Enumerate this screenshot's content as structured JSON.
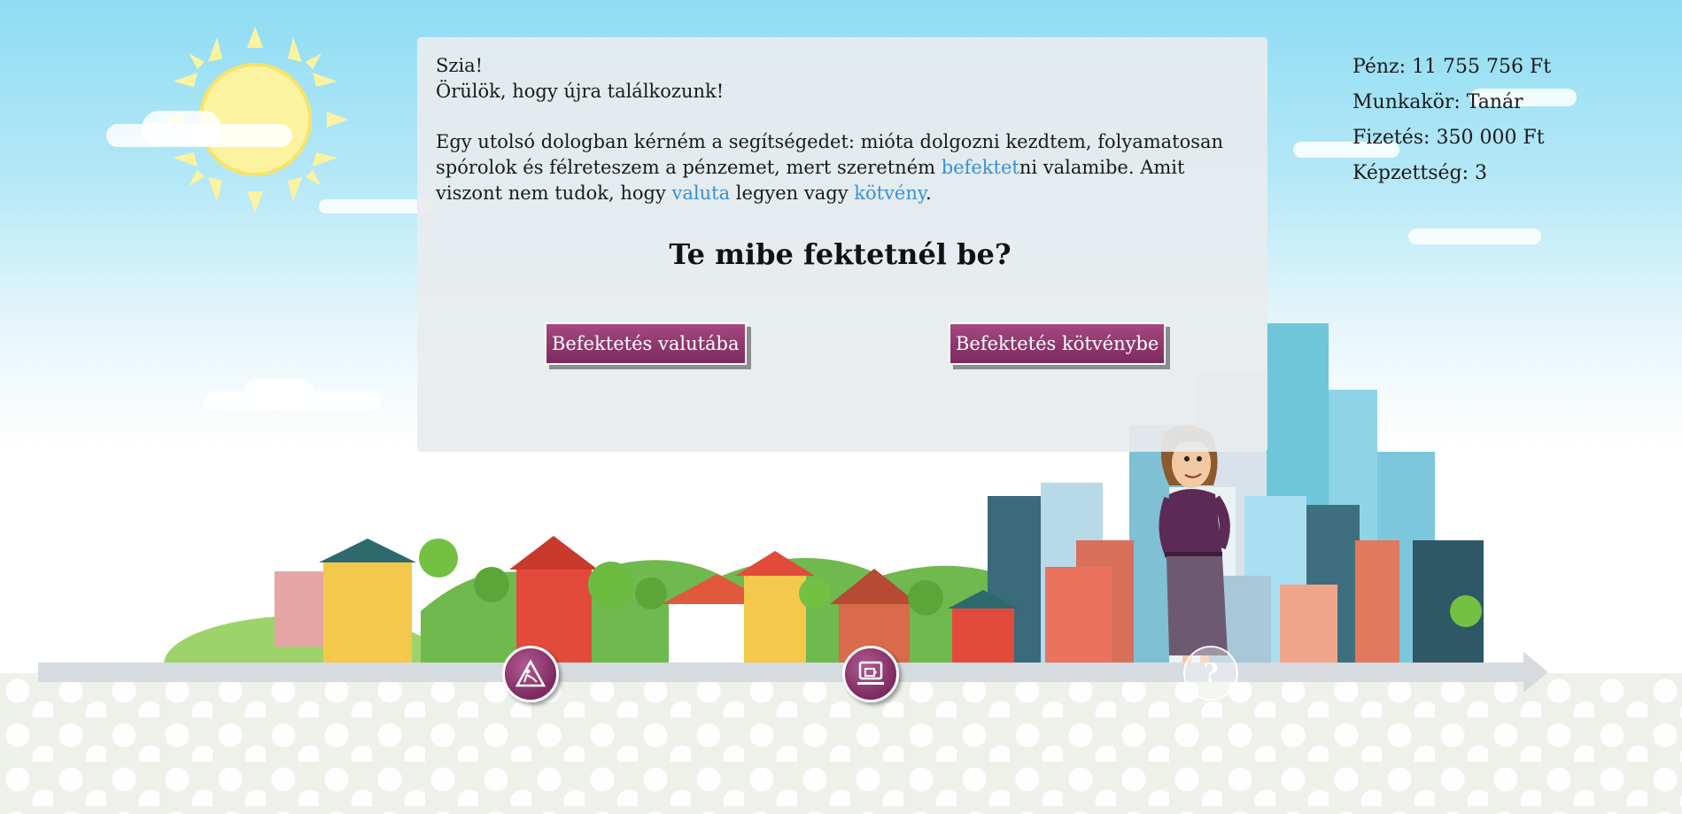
{
  "dialog": {
    "greeting": "Szia!",
    "subgreeting": "Örülök, hogy újra találkozunk!",
    "body_part1": "Egy utolsó dologban kérném a segítségedet: mióta dolgozni kezdtem, folyamatosan spórolok és félreteszem a pénzemet, mert szeretném ",
    "term_invest": "befektet",
    "body_part2": "ni valamibe. Amit viszont nem tudok, hogy ",
    "term_currency": "valuta",
    "body_part3": " legyen vagy ",
    "term_bond": "kötvény",
    "body_part4": ".",
    "question": "Te mibe fektetnél be?",
    "choice_currency": "Befektetés valutába",
    "choice_bond": "Befektetés kötvénybe"
  },
  "stats": {
    "money": "Pénz: 11 755 756 Ft",
    "job": "Munkakör: Tanár",
    "salary": "Fizetés: 350 000 Ft",
    "education": "Képzettség: 3"
  },
  "timeline": {
    "milestones": [
      {
        "icon": "construction-worker-icon",
        "state": "completed"
      },
      {
        "icon": "coffee-laptop-icon",
        "state": "completed"
      },
      {
        "icon": "question-mark-icon",
        "label": "?",
        "state": "upcoming"
      }
    ]
  },
  "colors": {
    "accent": "#7c2a5f",
    "link": "#3a8fd8",
    "panel": "#e8ecee",
    "sky": "#8fdcf3"
  }
}
